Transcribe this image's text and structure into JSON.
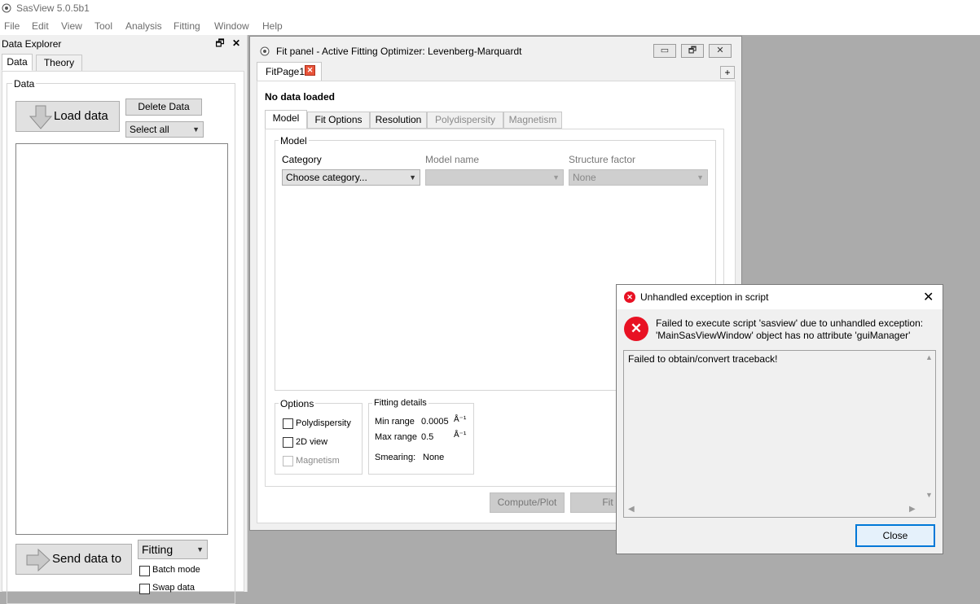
{
  "app": {
    "title": "SasView 5.0.5b1"
  },
  "menu": [
    "File",
    "Edit",
    "View",
    "Tool",
    "Analysis",
    "Fitting",
    "Window",
    "Help"
  ],
  "explorer": {
    "title": "Data Explorer",
    "tabs": [
      "Data",
      "Theory"
    ],
    "group_title": "Data",
    "load_label": "Load data",
    "delete_label": "Delete Data",
    "select_value": "Select all",
    "send_label": "Send data to",
    "send_target": "Fitting",
    "batch_label": "Batch mode",
    "swap_label": "Swap data"
  },
  "fit_panel": {
    "title": "Fit panel - Active Fitting Optimizer: Levenberg-Marquardt",
    "page_tab": "FitPage1",
    "add_tab": "+",
    "status": "No data loaded",
    "tabs": [
      "Model",
      "Fit Options",
      "Resolution",
      "Polydispersity",
      "Magnetism"
    ],
    "model_group": "Model",
    "category_label": "Category",
    "category_value": "Choose category...",
    "model_name_label": "Model name",
    "structure_label": "Structure factor",
    "structure_value": "None",
    "options_group": "Options",
    "opt_poly": "Polydispersity",
    "opt_2d": "2D view",
    "opt_magnetism": "Magnetism",
    "details_group": "Fitting details",
    "min_range_label": "Min range",
    "min_range_value": "0.0005",
    "max_range_label": "Max range",
    "max_range_value": "0.5",
    "unit": "Å⁻¹",
    "smearing_label": "Smearing:",
    "smearing_value": "None",
    "compute_label": "Compute/Plot",
    "fit_label": "Fit"
  },
  "dialog": {
    "title": "Unhandled exception in script",
    "message_line1": "Failed to execute script 'sasview' due to unhandled exception:",
    "message_line2": "'MainSasViewWindow' object has no attribute 'guiManager'",
    "traceback": "Failed to obtain/convert traceback!",
    "close_label": "Close"
  },
  "colors": {
    "error_red": "#e81123",
    "focus_blue": "#0078d7"
  }
}
